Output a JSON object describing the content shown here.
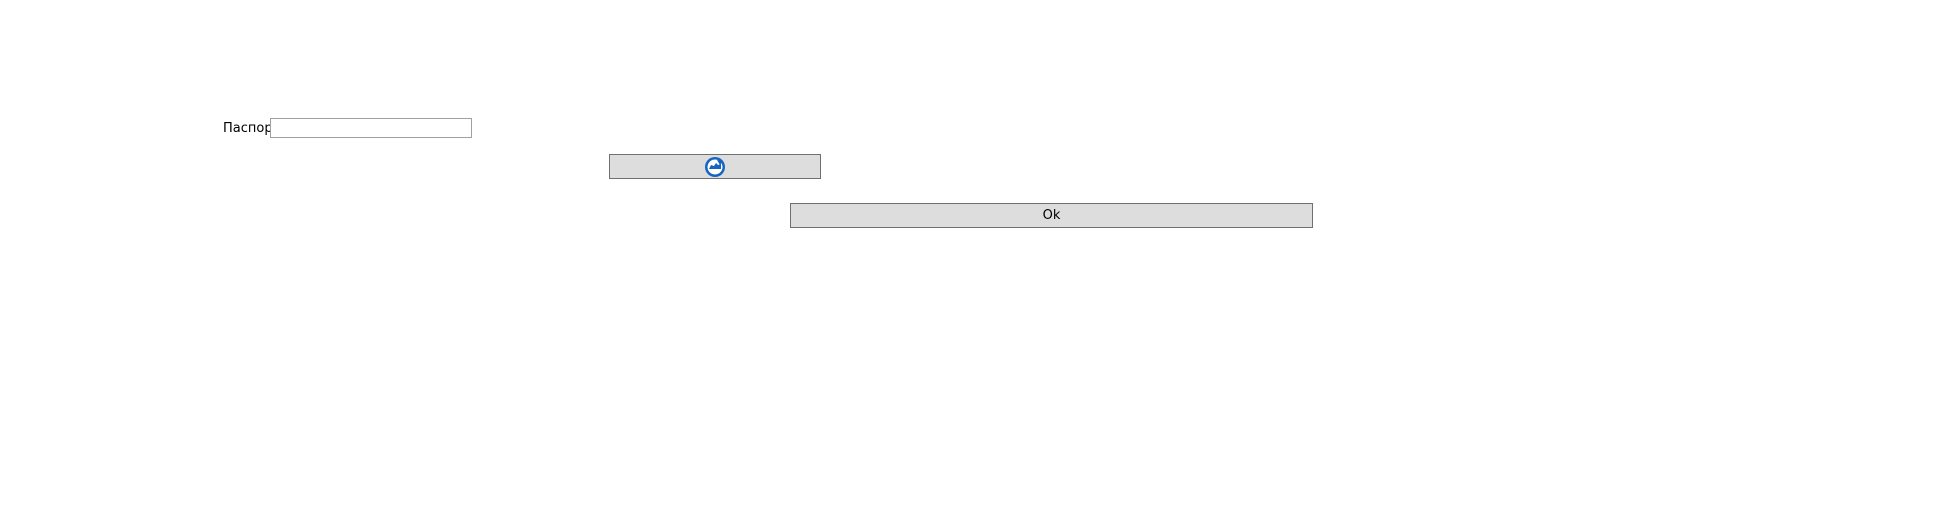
{
  "form": {
    "passport_label": "Паспорт",
    "passport_value": "",
    "icon_button": {
      "icon": "refresh-icon",
      "icon_color": "#1565c0"
    },
    "ok_label": "Ok"
  }
}
